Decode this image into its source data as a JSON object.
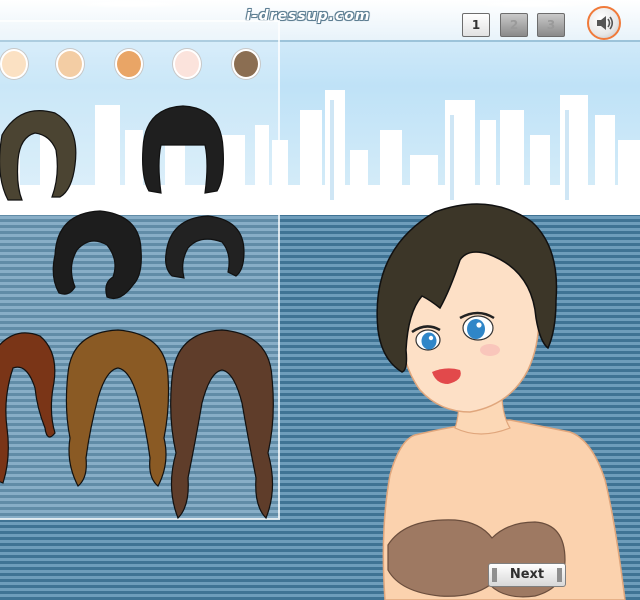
{
  "header": {
    "site_logo": "i-dressup.com",
    "pages": [
      "1",
      "2",
      "3"
    ],
    "active_page": "1",
    "sound_icon": "speaker-icon"
  },
  "skin_tones": [
    "#fbe1c3",
    "#f3cda4",
    "#e9a566",
    "#fbe3dc",
    "#8b6e52"
  ],
  "hair_options": [
    {
      "name": "olive-bob",
      "color": "#4b4432"
    },
    {
      "name": "black-bangs-bob",
      "color": "#1f1f1f"
    },
    {
      "name": "black-side-bob",
      "color": "#1d1d1d"
    },
    {
      "name": "black-swept-short",
      "color": "#222222"
    },
    {
      "name": "auburn-long",
      "color": "#7a3517"
    },
    {
      "name": "golden-brown-wavy",
      "color": "#8a5a24"
    },
    {
      "name": "brown-long-wavy",
      "color": "#5f3d2a"
    }
  ],
  "doll": {
    "hair_color": "#3c3628",
    "eye_color": "#2f86c8",
    "lip_color": "#e2494b",
    "top_color": "#8d6a55"
  },
  "next_label": "Next"
}
